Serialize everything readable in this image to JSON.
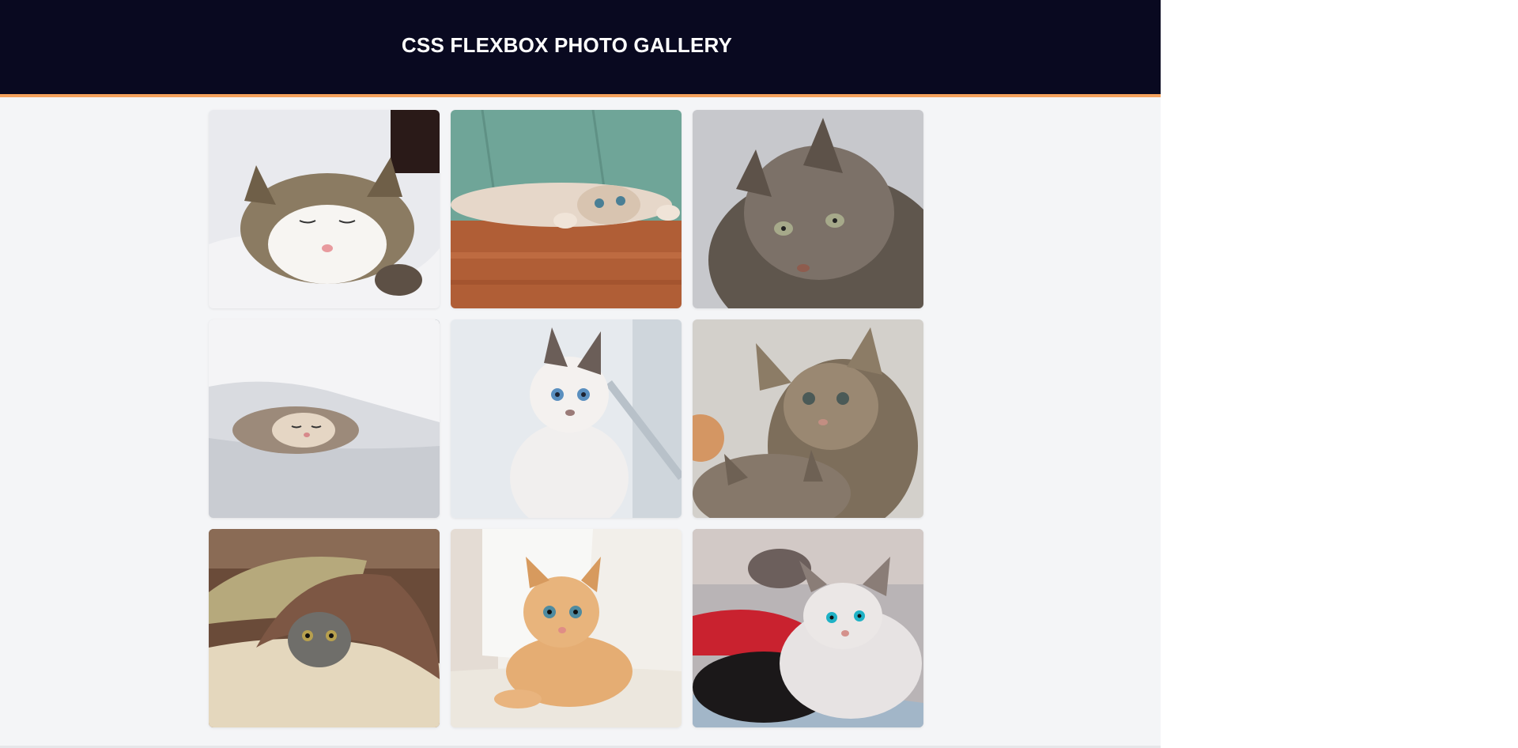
{
  "header": {
    "title": "CSS FLEXBOX PHOTO GALLERY",
    "background": "#090920",
    "accent": "#f5a25d"
  },
  "gallery": {
    "photos": [
      {
        "subject": "tabby-white cat sleeping on white bedding",
        "tone": "#8a7a66"
      },
      {
        "subject": "cream kitten lying upside down on wooden floor",
        "tone": "#7aa59c"
      },
      {
        "subject": "long-haired tabby cat close-up",
        "tone": "#7f7870"
      },
      {
        "subject": "kitten sleeping under white blanket",
        "tone": "#c9ccd3"
      },
      {
        "subject": "white siamese kitten by window",
        "tone": "#d7dce2"
      },
      {
        "subject": "two tabby kittens",
        "tone": "#8b7f70"
      },
      {
        "subject": "scottish fold cat under shaggy blanket",
        "tone": "#9a6c52"
      },
      {
        "subject": "orange kitten lying on white surface",
        "tone": "#dfb483"
      },
      {
        "subject": "white and black kittens on bed",
        "tone": "#8c8a93"
      }
    ]
  }
}
